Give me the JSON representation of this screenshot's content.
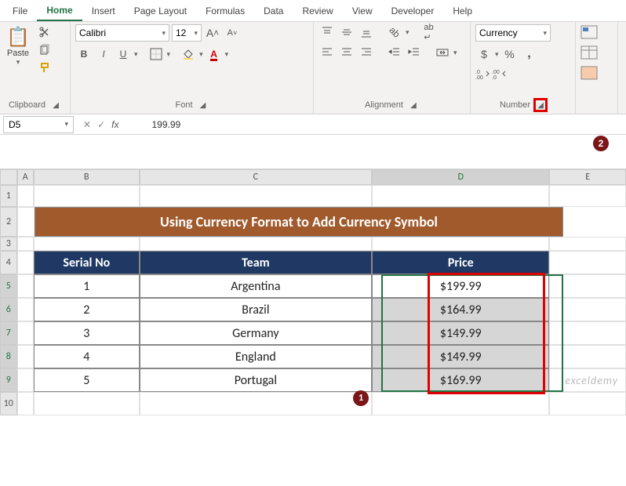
{
  "tabs": [
    "File",
    "Home",
    "Insert",
    "Page Layout",
    "Formulas",
    "Data",
    "Review",
    "View",
    "Developer",
    "Help"
  ],
  "active_tab": "Home",
  "clipboard": {
    "label": "Clipboard",
    "paste": "Paste"
  },
  "font": {
    "label": "Font",
    "name": "Calibri",
    "size": "12",
    "bold": "B",
    "italic": "I",
    "underline": "U"
  },
  "alignment": {
    "label": "Alignment"
  },
  "number": {
    "label": "Number",
    "format": "Currency",
    "currency": "$",
    "percent": "%",
    "comma": ",",
    "dec_inc": ".0",
    "dec_dec": ".00"
  },
  "namebox": "D5",
  "formula_value": "199.99",
  "cols": [
    "A",
    "B",
    "C",
    "D",
    "E"
  ],
  "rows": [
    "1",
    "2",
    "3",
    "4",
    "5",
    "6",
    "7",
    "8",
    "9",
    "10"
  ],
  "title": "Using Currency Format to Add Currency Symbol",
  "headers": {
    "b": "Serial No",
    "c": "Team",
    "d": "Price"
  },
  "data": [
    {
      "sn": "1",
      "team": "Argentina",
      "price": "$199.99"
    },
    {
      "sn": "2",
      "team": "Brazil",
      "price": "$164.99"
    },
    {
      "sn": "3",
      "team": "Germany",
      "price": "$149.99"
    },
    {
      "sn": "4",
      "team": "England",
      "price": "$149.99"
    },
    {
      "sn": "5",
      "team": "Portugal",
      "price": "$169.99"
    }
  ],
  "badges": {
    "one": "1",
    "two": "2"
  },
  "watermark": "exceldemy"
}
